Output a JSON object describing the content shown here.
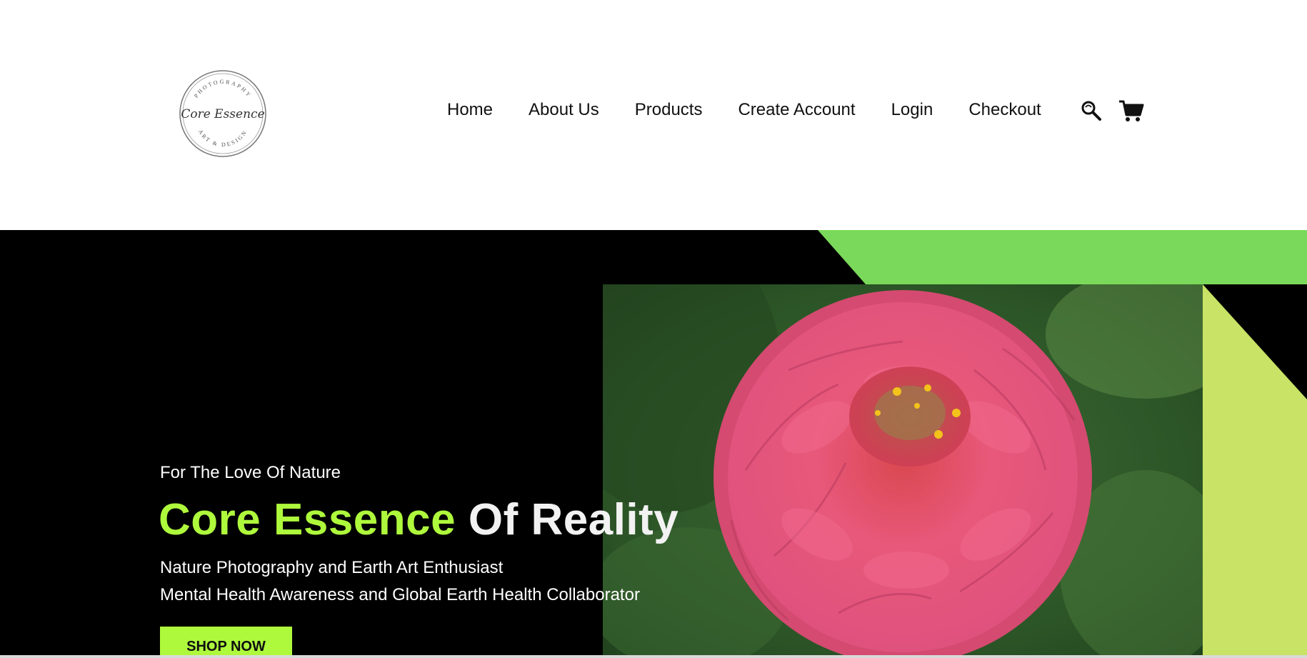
{
  "logo": {
    "top_text": "PHOTOGRAPHY",
    "script_text": "Core Essence",
    "bottom_text": "ART & DESIGN"
  },
  "nav": {
    "items": [
      {
        "label": "Home"
      },
      {
        "label": "About Us"
      },
      {
        "label": "Products"
      },
      {
        "label": "Create Account"
      },
      {
        "label": "Login"
      },
      {
        "label": "Checkout"
      }
    ]
  },
  "icons": {
    "search": "search-icon",
    "cart": "cart-icon"
  },
  "hero": {
    "tagline": "For The Love Of Nature",
    "title_part1": "Core Essence",
    "title_part2": "Of Reality",
    "line1": "Nature Photography and Earth Art Enthusiast",
    "line2": "Mental Health Awareness and Global Earth Health Collaborator",
    "cta": "SHOP NOW",
    "image": "pink zinnia flower photo"
  },
  "colors": {
    "accent_green": "#aef93c",
    "band_green": "#7ad95a",
    "lime_panel": "#c8e366",
    "hero_bg": "#000000"
  }
}
